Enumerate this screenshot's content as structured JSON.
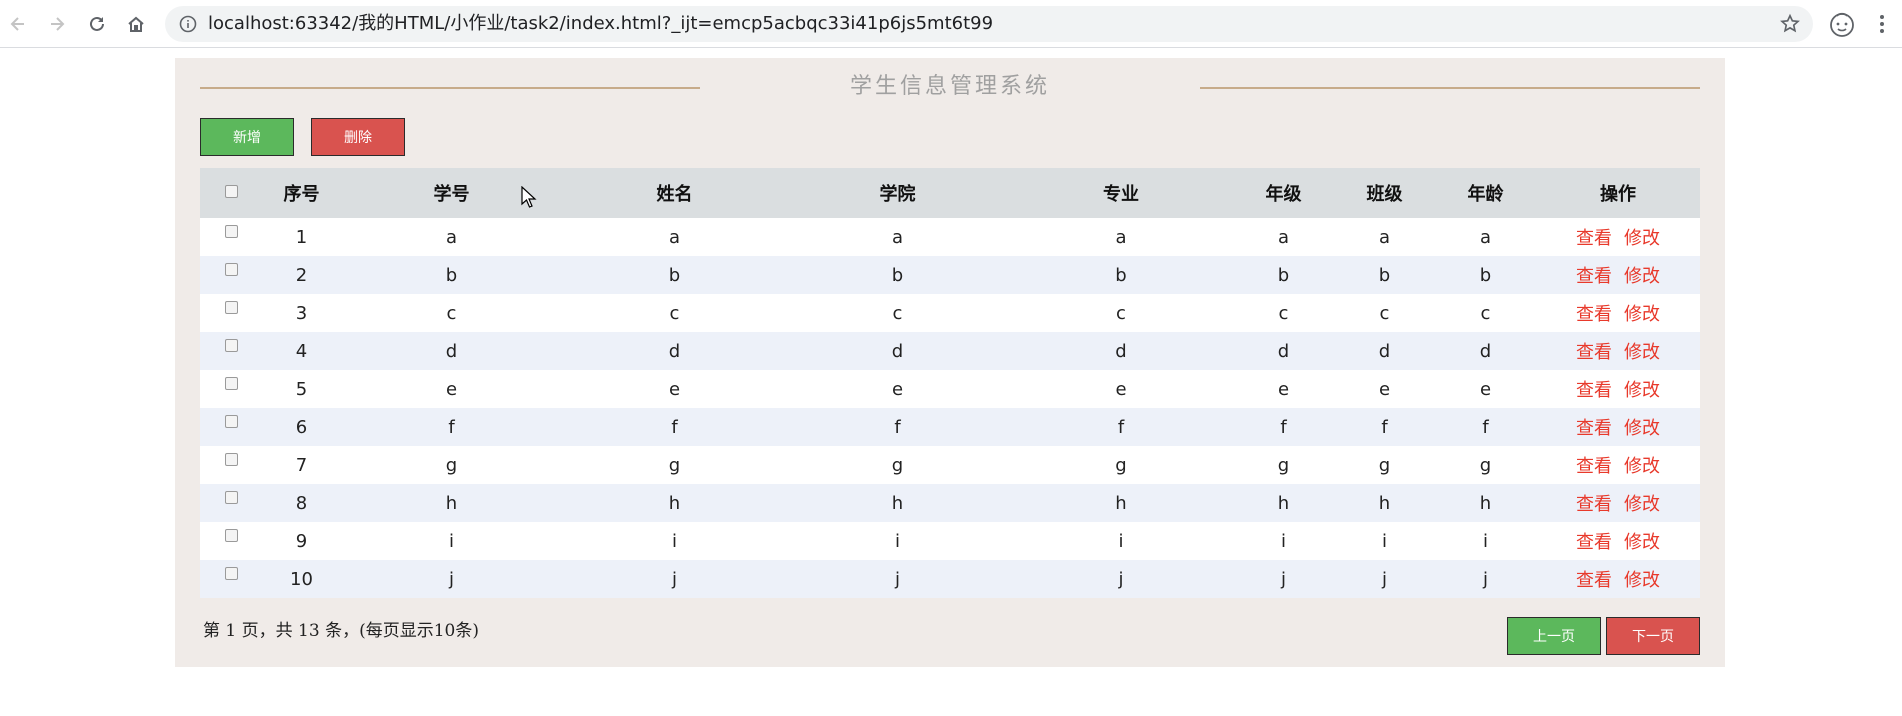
{
  "browser": {
    "url": "localhost:63342/我的HTML/小作业/task2/index.html?_ijt=emcp5acbqc33i41p6js5mt6t99"
  },
  "app": {
    "title": "学生信息管理系统",
    "add_label": "新增",
    "delete_label": "删除",
    "prev_label": "上一页",
    "next_label": "下一页",
    "pager_text": "第 1 页，共 13 条，(每页显示10条)"
  },
  "table": {
    "headers": [
      "序号",
      "学号",
      "姓名",
      "学院",
      "专业",
      "年级",
      "班级",
      "年龄",
      "操作"
    ],
    "view_label": "查看",
    "edit_label": "修改",
    "rows": [
      {
        "no": "1",
        "id": "a",
        "name": "a",
        "college": "a",
        "major": "a",
        "grade": "a",
        "class": "a",
        "age": "a"
      },
      {
        "no": "2",
        "id": "b",
        "name": "b",
        "college": "b",
        "major": "b",
        "grade": "b",
        "class": "b",
        "age": "b"
      },
      {
        "no": "3",
        "id": "c",
        "name": "c",
        "college": "c",
        "major": "c",
        "grade": "c",
        "class": "c",
        "age": "c"
      },
      {
        "no": "4",
        "id": "d",
        "name": "d",
        "college": "d",
        "major": "d",
        "grade": "d",
        "class": "d",
        "age": "d"
      },
      {
        "no": "5",
        "id": "e",
        "name": "e",
        "college": "e",
        "major": "e",
        "grade": "e",
        "class": "e",
        "age": "e"
      },
      {
        "no": "6",
        "id": "f",
        "name": "f",
        "college": "f",
        "major": "f",
        "grade": "f",
        "class": "f",
        "age": "f"
      },
      {
        "no": "7",
        "id": "g",
        "name": "g",
        "college": "g",
        "major": "g",
        "grade": "g",
        "class": "g",
        "age": "g"
      },
      {
        "no": "8",
        "id": "h",
        "name": "h",
        "college": "h",
        "major": "h",
        "grade": "h",
        "class": "h",
        "age": "h"
      },
      {
        "no": "9",
        "id": "i",
        "name": "i",
        "college": "i",
        "major": "i",
        "grade": "i",
        "class": "i",
        "age": "i"
      },
      {
        "no": "10",
        "id": "j",
        "name": "j",
        "college": "j",
        "major": "j",
        "grade": "j",
        "class": "j",
        "age": "j"
      }
    ]
  },
  "colors": {
    "panel_bg": "#f0ebe8",
    "success": "#5cb85c",
    "danger": "#d9534f",
    "link": "#e8392b",
    "header_bg": "#dadee0",
    "stripe": "#edf1f9"
  }
}
